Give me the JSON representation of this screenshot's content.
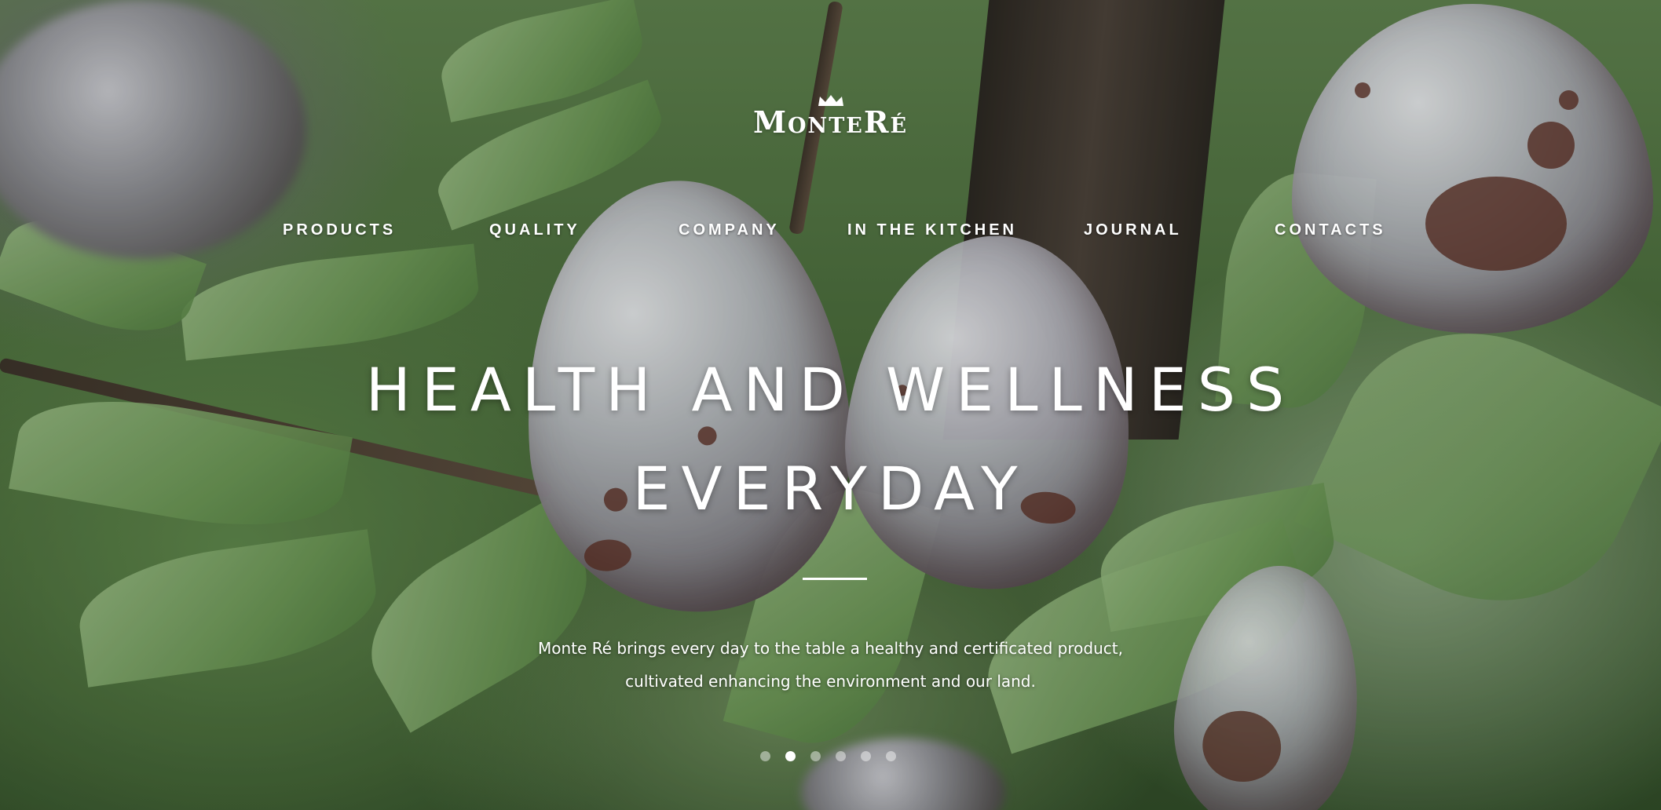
{
  "brand": {
    "logo_text": "MonteRé"
  },
  "nav": {
    "items": [
      {
        "label": "PRODUCTS"
      },
      {
        "label": "QUALITY"
      },
      {
        "label": "COMPANY"
      },
      {
        "label": "IN THE KITCHEN"
      },
      {
        "label": "JOURNAL"
      },
      {
        "label": "CONTACTS"
      }
    ]
  },
  "hero": {
    "headline_line1": "HEALTH AND WELLNESS",
    "headline_line2": "EVERYDAY",
    "subtitle_line1": "Monte Ré brings every day to the table a healthy and certificated product,",
    "subtitle_line2": "cultivated enhancing the environment and our land."
  },
  "slider": {
    "total_slides": 6,
    "active_slide": 2
  },
  "colors": {
    "text": "#ffffff",
    "foliage": "#5d7f4c",
    "plum": "#b9b9c1"
  }
}
